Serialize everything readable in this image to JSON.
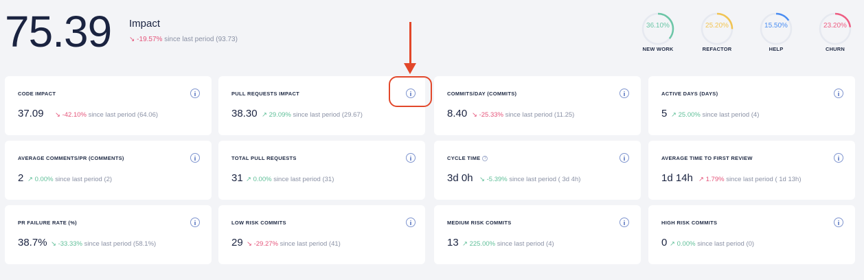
{
  "impact": {
    "score": "75.39",
    "title": "Impact",
    "change_arrow": "↘",
    "change_pct": "-19.57%",
    "change_text": "since last period (93.73)"
  },
  "distribution": [
    {
      "label": "NEW WORK",
      "percent_text": "36.10%",
      "value": 36.1,
      "color": "#6cc6a7"
    },
    {
      "label": "REFACTOR",
      "percent_text": "25.20%",
      "value": 25.2,
      "color": "#f1c453"
    },
    {
      "label": "HELP",
      "percent_text": "15.50%",
      "value": 15.5,
      "color": "#4a8df2"
    },
    {
      "label": "CHURN",
      "percent_text": "23.20%",
      "value": 23.2,
      "color": "#ee5d82"
    }
  ],
  "metrics": [
    {
      "title": "CODE IMPACT",
      "value": "37.09",
      "arrow": "↘",
      "pct": "-42.10%",
      "trend": "neg",
      "rest": "since last period (64.06)"
    },
    {
      "title": "PULL REQUESTS IMPACT",
      "value": "38.30",
      "arrow": "↗",
      "pct": "29.09%",
      "trend": "pos",
      "rest": "since last period (29.67)"
    },
    {
      "title": "COMMITS/DAY (COMMITS)",
      "value": "8.40",
      "arrow": "↘",
      "pct": "-25.33%",
      "trend": "neg",
      "rest": "since last period (11.25)"
    },
    {
      "title": "ACTIVE DAYS (DAYS)",
      "value": "5",
      "arrow": "↗",
      "pct": "25.00%",
      "trend": "pos",
      "rest": "since last period (4)"
    },
    {
      "title": "AVERAGE COMMENTS/PR (COMMENTS)",
      "value": "2",
      "arrow": "↗",
      "pct": "0.00%",
      "trend": "pos",
      "rest": "since last period (2)"
    },
    {
      "title": "TOTAL PULL REQUESTS",
      "value": "31",
      "arrow": "↗",
      "pct": "0.00%",
      "trend": "pos",
      "rest": "since last period (31)"
    },
    {
      "title": "CYCLE TIME",
      "value": "3d 0h",
      "arrow": "↘",
      "pct": "-5.39%",
      "trend": "pos",
      "rest": "since last period ( 3d 4h)"
    },
    {
      "title": "AVERAGE TIME TO FIRST REVIEW",
      "value": "1d 14h",
      "arrow": "↗",
      "pct": "1.79%",
      "trend": "neg",
      "rest": "since last period ( 1d 13h)"
    },
    {
      "title": "PR FAILURE RATE (%)",
      "value": "38.7%",
      "arrow": "↘",
      "pct": "-33.33%",
      "trend": "pos",
      "rest": "since last period (58.1%)"
    },
    {
      "title": "LOW RISK COMMITS",
      "value": "29",
      "arrow": "↘",
      "pct": "-29.27%",
      "trend": "neg",
      "rest": "since last period (41)"
    },
    {
      "title": "MEDIUM RISK COMMITS",
      "value": "13",
      "arrow": "↗",
      "pct": "225.00%",
      "trend": "pos",
      "rest": "since last period (4)"
    },
    {
      "title": "HIGH RISK COMMITS",
      "value": "0",
      "arrow": "↗",
      "pct": "0.00%",
      "trend": "pos",
      "rest": "since last period (0)"
    }
  ],
  "cycle_time_help": "?"
}
